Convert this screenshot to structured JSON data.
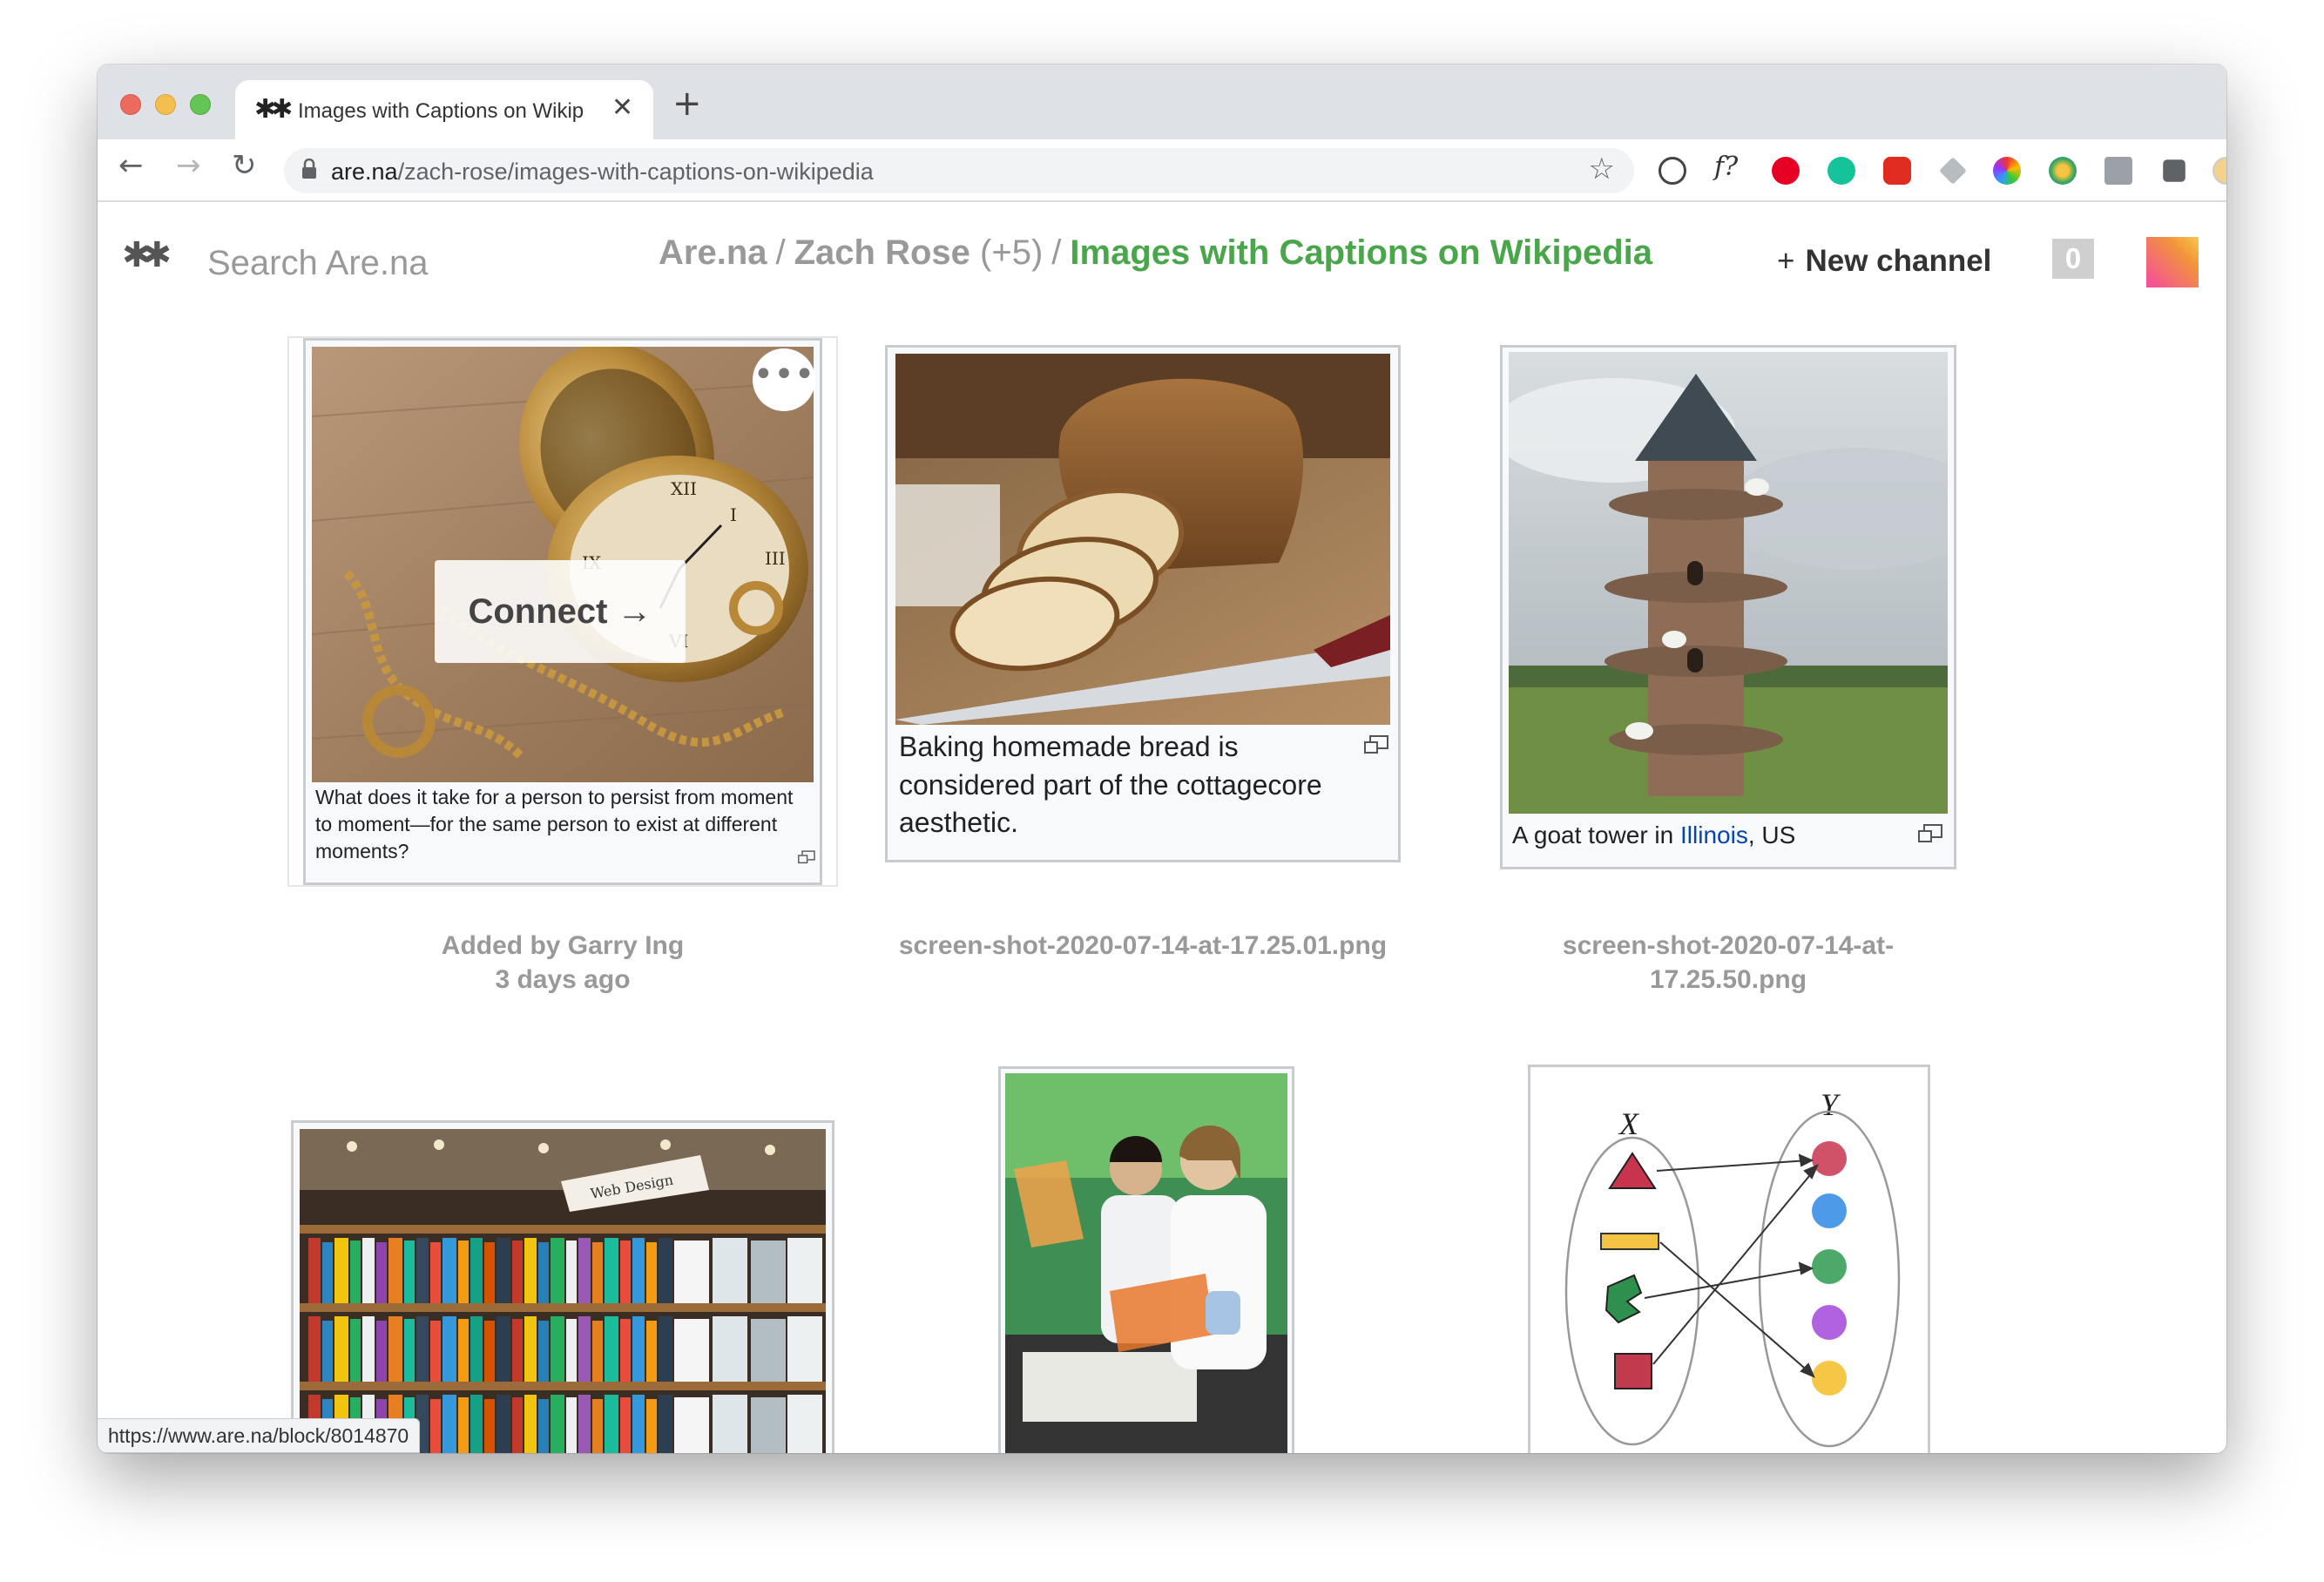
{
  "browser": {
    "tab_title": "Images with Captions on Wikip",
    "tab_favicon": "✱✱",
    "url_host": "are.na",
    "url_path": "/zach-rose/images-with-captions-on-wikipedia",
    "status_url": "https://www.are.na/block/8014870",
    "icons": [
      "back-icon",
      "forward-icon",
      "reload-icon",
      "lock-icon",
      "star-icon",
      "extension-icons",
      "kebab-menu-icon"
    ]
  },
  "header": {
    "logo": "✱✱",
    "search_placeholder": "Search Are.na",
    "crumb_root": "Are.na",
    "crumb_sep": "/",
    "crumb_user": "Zach Rose",
    "crumb_user_count": "(+5)",
    "crumb_channel": "Images with Captions on Wikipedia",
    "new_channel_plus": "+",
    "new_channel_label": "New channel",
    "notifications_count": "0",
    "accent": "#4aa64b"
  },
  "blocks": [
    {
      "caption": "What does it take for a person to persist from moment to moment—for the same person to exist at different moments?",
      "connect_label": "Connect →",
      "more_label": "•••",
      "meta_line1": "Added by Garry Ing",
      "meta_line2": "3 days ago"
    },
    {
      "caption": "Baking homemade bread is considered part of the cottagecore aesthetic.",
      "meta_line1": "screen-shot-2020-07-14-at-17.25.01.png"
    },
    {
      "caption_pre": "A goat tower in ",
      "caption_link": "Illinois",
      "caption_post": ", US",
      "meta_line1": "screen-shot-2020-07-14-at-17.25.50.png"
    },
    {
      "image": "bookstore-shelves",
      "sign_text": "Web Design"
    },
    {
      "image": "lab-scientists"
    },
    {
      "image": "set-mapping-diagram",
      "label_x": "X",
      "label_y": "Y"
    }
  ]
}
